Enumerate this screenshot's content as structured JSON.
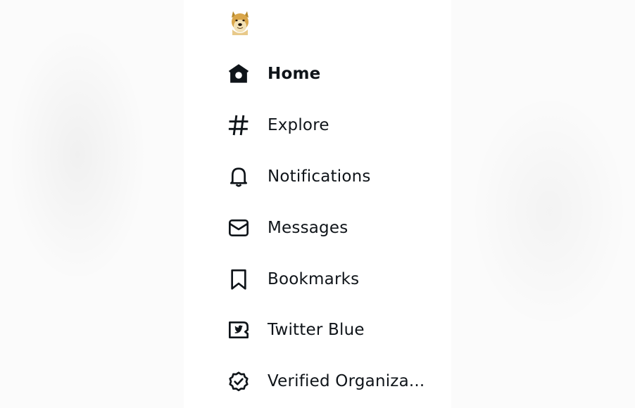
{
  "logo": {
    "icon": "doge-avatar-icon"
  },
  "nav": {
    "items": [
      {
        "label": "Home",
        "icon": "home-icon",
        "active": true
      },
      {
        "label": "Explore",
        "icon": "hashtag-icon"
      },
      {
        "label": "Notifications",
        "icon": "bell-icon"
      },
      {
        "label": "Messages",
        "icon": "envelope-icon"
      },
      {
        "label": "Bookmarks",
        "icon": "bookmark-icon"
      },
      {
        "label": "Twitter Blue",
        "icon": "twitter-blue-icon"
      },
      {
        "label": "Verified Organiza...",
        "icon": "verified-badge-icon"
      }
    ]
  },
  "colors": {
    "text": "#0f1419",
    "background": "#ffffff"
  }
}
